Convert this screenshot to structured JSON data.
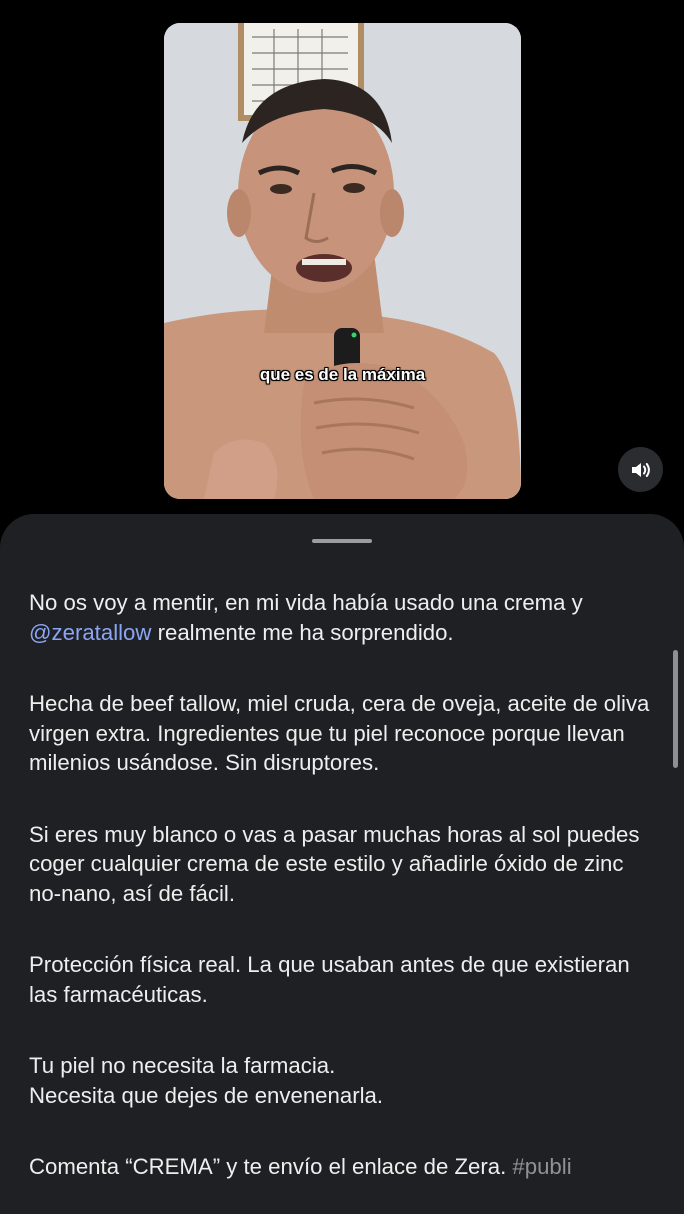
{
  "video": {
    "subtitle": "que es de la máxima"
  },
  "sound_button": {
    "icon": "speaker-wave-icon"
  },
  "caption": {
    "p1_before": "No os voy a mentir, en mi vida había usado una crema y ",
    "p1_mention": "@zeratallow",
    "p1_after": " realmente me ha sorprendido.",
    "p2": "Hecha de beef tallow, miel cruda, cera de oveja, aceite de oliva virgen extra. Ingredientes que tu piel reconoce porque llevan milenios usándose. Sin disruptores.",
    "p3": "Si eres muy blanco o vas a pasar muchas horas al sol puedes coger cualquier crema de este estilo y añadirle óxido de zinc no-nano, así de fácil.",
    "p4": "Protección física real. La que usaban antes de que existieran las farmacéuticas.",
    "p5_line1": "Tu piel no necesita la farmacia.",
    "p5_line2": "Necesita que dejes de envenenarla.",
    "p6_text": "Comenta “CREMA” y te envío el enlace de Zera. ",
    "p6_hashtag": "#publi"
  },
  "colors": {
    "background": "#000000",
    "sheet": "#1f2023",
    "text": "#eeeeee",
    "link": "#8ba5f5",
    "hashtag": "#8f9197"
  }
}
